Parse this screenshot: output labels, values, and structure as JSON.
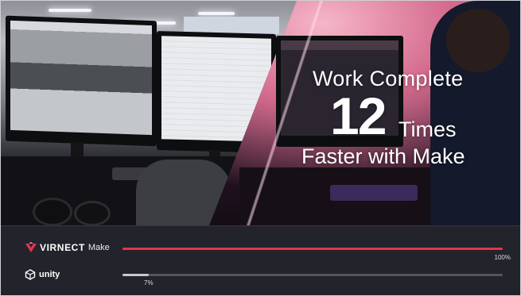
{
  "headline": {
    "line1": "Work Complete",
    "number": "12",
    "times": "Times",
    "line3": "Faster with Make"
  },
  "comparison": {
    "virnect": {
      "brand_strong": "VIRNECT",
      "brand_light": "Make",
      "percent_label": "100%",
      "progress": 1.0,
      "color": "#e6334e",
      "icon": "virnect-logo-icon"
    },
    "unity": {
      "brand": "unity",
      "percent_label": "7%",
      "progress": 0.07,
      "color": "#c8c8ce",
      "icon": "unity-logo-icon"
    }
  },
  "colors": {
    "panel_bg": "#23232b",
    "accent": "#e6334e"
  }
}
